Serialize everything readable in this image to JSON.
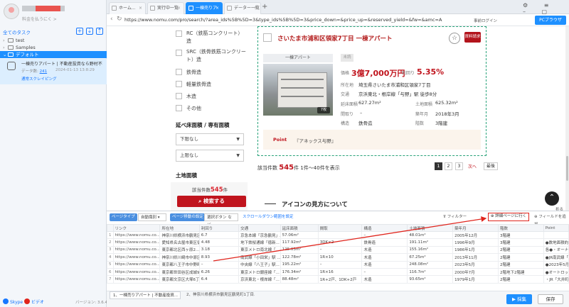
{
  "sidebar": {
    "user_sub": "料金を払うにく >",
    "all_tasks": "全てのタスク",
    "tree": [
      {
        "label": "test"
      },
      {
        "label": "Samples"
      },
      {
        "label": "デフォルト"
      }
    ],
    "task": {
      "title": "一棟売りアパート | 不動産投資なら野村不",
      "count_label": "データ数:",
      "count": "241",
      "date": "2024-01-13 13:8:29",
      "mode": "通常スクレイピング"
    },
    "footer": {
      "skype": "Skype",
      "video": "ビデオ",
      "version": "バージョン: 3.6.4"
    }
  },
  "tabs": [
    {
      "label": "ホーム..."
    },
    {
      "label": "実行中一覧"
    },
    {
      "label": "一棟売りア"
    },
    {
      "label": "データー一覧"
    }
  ],
  "address": {
    "url": "https://www.nomu.com/pro/search/?area_ids%5B%5D=3&type_ids%5B%5D=3&price_down=&price_up=&reserved_yield=&fw=&amc=A",
    "prelogin": "事前ログイン",
    "pc_version": "PCブラウザ"
  },
  "filters": {
    "structure_items": [
      "RC（鉄筋コンクリート）造",
      "SRC（鉄骨鉄筋コンクリート）造",
      "鉄骨造",
      "軽量鉄骨造",
      "木造",
      "その他"
    ],
    "floor_area_title": "延べ床面積 / 専有面積",
    "lower_none": "下限なし",
    "upper_none": "上限なし",
    "land_area_title": "土地面積",
    "hits_prefix": "該当件数",
    "hits_count": "545",
    "hits_suffix": "件",
    "search_button": "検索する"
  },
  "property": {
    "title": "さいたま市浦和区領家7丁目 一棟アパート",
    "request_button": "資料請求",
    "type_badge": "一棟アパート",
    "unseen_badge": "未読",
    "photo_count": "7枚",
    "price_label": "価格",
    "price_value": "3億7,000万円",
    "yield_label": "利回り",
    "yield_value": "5.35%",
    "address_label": "所在地",
    "address_value": "埼玉県さいたま市浦和区領家7丁目",
    "access_label": "交通",
    "access_value": "京浜東北・根岸線「与野」駅 徒歩8分",
    "building_area_label": "延床面積",
    "building_area_value": "627.27m²",
    "land_area_label": "土地面積",
    "land_area_value": "625.32m²",
    "layout_label": "間取り",
    "layout_value": "–",
    "built_label": "築年月",
    "built_value": "2018年3月",
    "structure_label": "構造",
    "structure_value": "鉄骨造",
    "floors_label": "階数",
    "floors_value": "3階建",
    "point_label": "Point",
    "point_text": "『アネックス与野』"
  },
  "results": {
    "total_prefix": "該当件数",
    "total_count": "545",
    "total_suffix": "件 1件〜40件を表示",
    "pages": [
      "1",
      "2",
      "3"
    ],
    "next": "次へ",
    "last": "最後",
    "icon_legend_title": "アイコンの見方について",
    "fold": "折る"
  },
  "panel": {
    "toolbar": {
      "page_type_label": "ページタイプ",
      "page_type_value": "自動識別",
      "page_turn_label": "ページ移動の設定",
      "page_turn_value": "選択ボタン など...",
      "scroll_label": "スクロールダウン範囲を設定",
      "filter": "フィルター",
      "detail_page": "詳細ページに行く",
      "add_field": "フィールドを追加"
    },
    "columns": [
      "リンク",
      "所在地",
      "利回り",
      "交通",
      "延床面積",
      "間取",
      "構造",
      "土地面積",
      "築年月",
      "階数",
      "Point"
    ],
    "rows": [
      [
        "https://www.nomu.co...",
        "神奈川県横浜市鶴見区",
        "6.7",
        "京急本線「京急鶴見」...",
        "57.06m²",
        "",
        "–",
        "48.01m²",
        "2005年12月",
        "3階建",
        ""
      ],
      [
        "https://www.nomu.co...",
        "愛知県名古屋市東区徳",
        "4.48",
        "地下鉄桜通線「徳新...",
        "117.92m²",
        "3DK×2",
        "鉄骨造",
        "191.11m²",
        "1996年9月",
        "3階建",
        "●数地面積約57.81坪"
      ],
      [
        "https://www.nomu.co...",
        "東京都北区西ヶ原2...",
        "3.18",
        "東京メトロ南北線「...",
        "125.03m²",
        "–",
        "木造",
        "155.16m²",
        "1986年1月",
        "2階建",
        "各●・オーナーチェン"
      ],
      [
        "https://www.nomu.co...",
        "神奈川県川崎市中原区",
        "8.93",
        "南武線「小田栄」駅 ...",
        "122.78m²",
        "1R×10",
        "木造",
        "67.25m²",
        "2013年11月",
        "2階建",
        "●JR南武線「小田栄」駅"
      ],
      [
        "https://www.nomu.co...",
        "東京都八王子市中野町",
        "–",
        "中央線「八王子」駅...",
        "195.22m²",
        "–",
        "木造",
        "248.08m²",
        "2023年5月",
        "2階建",
        "●2023年5月末 新築"
      ],
      [
        "https://www.nomu.co...",
        "東京都世田谷区成城9",
        "6.26",
        "東京メトロ銀座線「...",
        "176.34m²",
        "1R×16",
        "–",
        "116.7m²",
        "2000年7月",
        "2階地下2階建",
        "●オートロック付"
      ],
      [
        "https://www.nomu.co...",
        "東京都文京区大塚6丁目",
        "6.4",
        "京浜東北・根岸線「...",
        "88.48m²",
        "1R+2戸、1DK+2戸",
        "木造",
        "93.65m²",
        "1979年1月",
        "2階建",
        "・JR「大井町」駅"
      ]
    ]
  },
  "bottom": {
    "tab1": "1、一棟売りアパート | 不動産投資...",
    "tab2": "2、神奈川県横浜市鶴見区鶴見町1丁目...",
    "collect": "▶ 採集",
    "save": "保存"
  },
  "colors": {
    "accent": "#1e90ff",
    "brand_red": "#c0141d",
    "annotation_red": "#e0241c"
  }
}
